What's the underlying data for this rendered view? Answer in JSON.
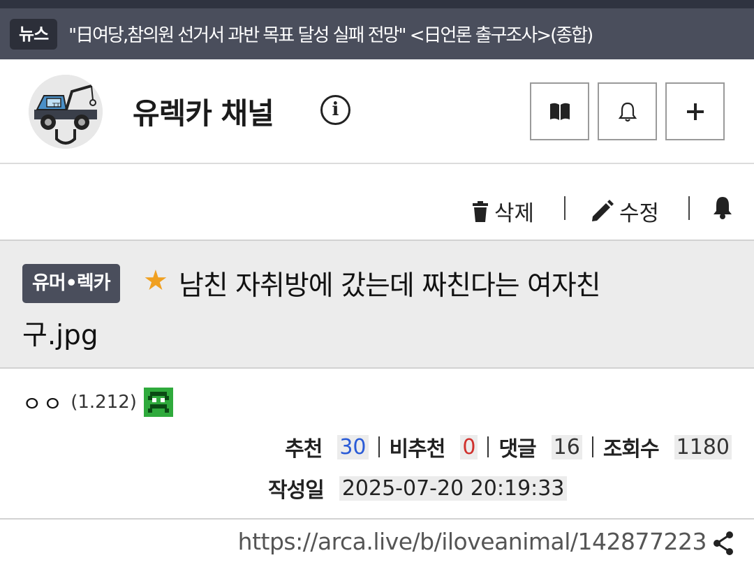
{
  "news": {
    "badge": "뉴스",
    "headline": "\"日여당,참의원 선거서 과반 목표 달성 실패 전망\" <日언론 출구조사>(종합)"
  },
  "channel": {
    "name": "유렉카 채널",
    "info_glyph": "i",
    "buttons": [
      {
        "icon": "book-icon"
      },
      {
        "icon": "bell-outline-icon"
      },
      {
        "icon": "plus-icon"
      }
    ]
  },
  "actions": {
    "delete_label": "삭제",
    "edit_label": "수정",
    "notify_icon": "bell-icon"
  },
  "post": {
    "category": "유머•렉카",
    "title_line1": "남친 자취방에 갔는데 짜친다는 여자친",
    "title_line2": "구.jpg",
    "star": "★"
  },
  "author": {
    "name": "ㅇㅇ",
    "id": "(1.212)"
  },
  "stats": {
    "upvote_label": "추천",
    "upvote_value": "30",
    "downvote_label": "비추천",
    "downvote_value": "0",
    "comments_label": "댓글",
    "comments_value": "16",
    "views_label": "조회수",
    "views_value": "1180",
    "date_label": "작성일",
    "date_value": "2025-07-20 20:19:33"
  },
  "url": "https://arca.live/b/iloveanimal/142877223",
  "colors": {
    "news_bar": "#4a4e5c",
    "badge_bg": "#4a4e5c",
    "upvote": "#2a5bd7",
    "downvote": "#d0312d",
    "star": "#f0a020"
  }
}
